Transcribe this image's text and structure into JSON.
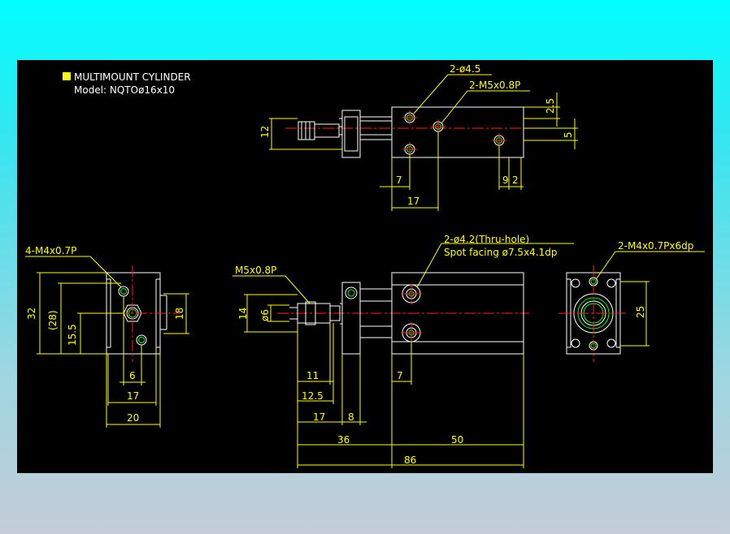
{
  "title_block": {
    "title": "MULTIMOUNT CYLINDER",
    "model": "Model: NQTOø16x10",
    "marker_color": "#ffff00"
  },
  "colors": {
    "background_top": "#00ffff",
    "sheet": "#000000",
    "outline": "#ffffff",
    "dimension": "#ffff00",
    "centerline": "#ff2020",
    "thread": "#00ff00"
  },
  "top_view": {
    "callouts": [
      "2-ø4.5",
      "2-M5x0.8P"
    ],
    "dims": [
      "12",
      "2.5",
      "5",
      "7",
      "9",
      "2",
      "17"
    ]
  },
  "left_view": {
    "callout": "4-M4x0.7P",
    "dims": [
      "32",
      "(28)",
      "15.5",
      "18",
      "6",
      "17",
      "20"
    ]
  },
  "front_view": {
    "thread_callout": "M5x0.8P",
    "hole_callout_1": "2-ø4.2(Thru-hole)",
    "hole_callout_2": "Spot facing ø7.5x4.1dp",
    "dims": [
      "14",
      "ø6",
      "11",
      "12.5",
      "17",
      "8",
      "7",
      "36",
      "50",
      "86"
    ]
  },
  "right_view": {
    "callout": "2-M4x0.7Px6dp",
    "dims": [
      "25"
    ]
  }
}
